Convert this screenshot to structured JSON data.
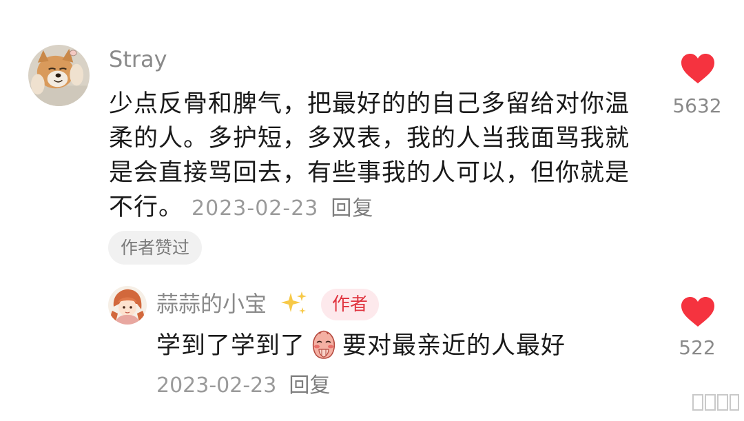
{
  "comment": {
    "username": "Stray",
    "text": "少点反骨和脾气，把最好的的自己多留给对你温柔的人。多护短，多双表，我的人当我面骂我就是会直接骂回去，有些事我的人可以，但你就是不行。",
    "date": "2023-02-23",
    "reply_label": "回复",
    "liked_by_author_label": "作者赞过",
    "like_count": "5632",
    "avatar_icon": "dog-photo-avatar",
    "like_icon": "heart-icon",
    "like_color": "#f5333f"
  },
  "reply": {
    "username": "蒜蒜的小宝",
    "author_tag": "作者",
    "text_before_emoji": "学到了学到了",
    "emoji_icon": "blushing-face-emoji",
    "text_after_emoji": "要对最亲近的人最好",
    "date": "2023-02-23",
    "reply_label": "回复",
    "like_count": "522",
    "avatar_icon": "anime-girl-avatar",
    "badge_icon": "sparkles-icon",
    "like_icon": "heart-icon",
    "like_color": "#f5333f",
    "tag_color": "#e0343f"
  }
}
